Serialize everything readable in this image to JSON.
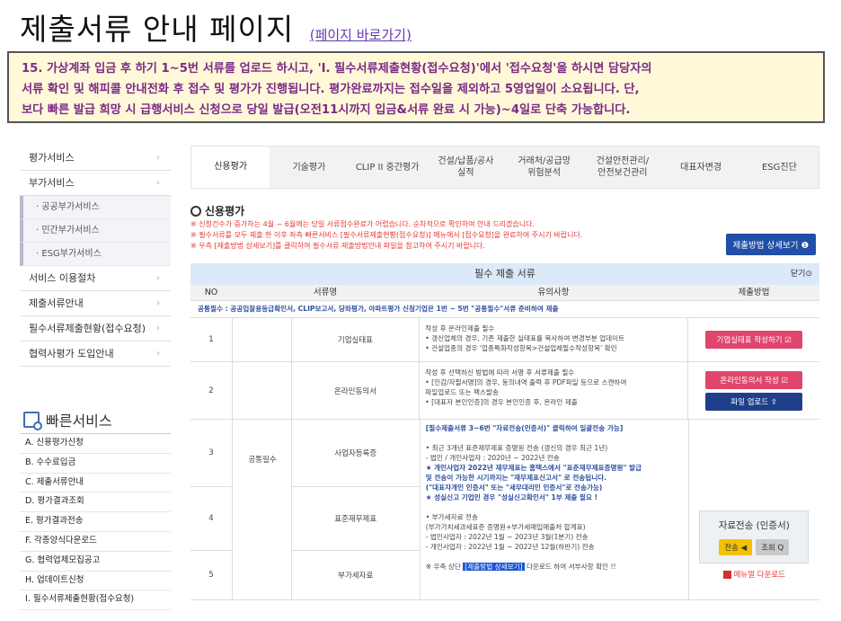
{
  "page": {
    "title": "제출서류 안내 페이지",
    "title_link": "(페이지 바로가기)",
    "notice": [
      "15. 가상계좌 입금 후 하기 1~5번 서류를 업로드 하시고, 'I. 필수서류제출현황(접수요청)'에서 '접수요청'을 하시면 담당자의",
      "서류 확인 및 해피콜 안내전화 후 접수 및 평가가 진행됩니다. 평가완료까지는 접수일을 제외하고 5영업일이 소요됩니다. 단,",
      "보다 빠른 발급 희망 시 급행서비스 신청으로 당일 발급(오전11시까지 입금&서류 완료 시 가능)~4일로 단축 가능합니다."
    ]
  },
  "sidebar": {
    "items": [
      {
        "label": "평가서비스"
      },
      {
        "label": "부가서비스"
      }
    ],
    "subitems": [
      "· 공공부가서비스",
      "· 민간부가서비스",
      "· ESG부가서비스"
    ],
    "items2": [
      {
        "label": "서비스 이용절차"
      },
      {
        "label": "제출서류안내"
      },
      {
        "label": "필수서류제출현황(접수요청)"
      },
      {
        "label": "협력사평가 도입안내"
      }
    ],
    "quick_title": "빠른서비스",
    "quick": [
      "A. 신용평가신청",
      "B. 수수료입금",
      "C. 제출서류안내",
      "D. 평가결과조회",
      "E. 평가결과전송",
      "F. 각종양식다운로드",
      "G. 협력업체모집공고",
      "H. 업데이트신청",
      "I. 필수서류제출현황(접수요청)"
    ]
  },
  "tabs": [
    {
      "label": "신용평가",
      "active": true
    },
    {
      "label": "기술평가"
    },
    {
      "label": "CLIP II 중간평가"
    },
    {
      "label": "건설/납품/공사\n실적"
    },
    {
      "label": "거래처/공급망\n위험분석"
    },
    {
      "label": "건설안전관리/\n안전보건관리"
    },
    {
      "label": "대표자변경"
    },
    {
      "label": "ESG진단"
    }
  ],
  "section": {
    "title": "신용평가",
    "notes": [
      "※ 신청건수가 증가하는 4월 ~ 6월에는 당일 서류접수완료가 어렵습니다. 순차적으로 확인하여 안내 드리겠습니다.",
      "※ 필수서류를 모두 제출 한 이후 좌측 빠른서비스 [필수서류제출현황(접수요청)] 메뉴에서 [접수요청]을 완료하여 주시기 바랍니다.",
      "※ 우측 [제출방법 상세보기]를 클릭하여 필수서류 제출방법안내 파일을 참고하여 주시기 바랍니다."
    ],
    "method_button": "제출방법 상세보기 ❶"
  },
  "table": {
    "title": "필수 제출 서류",
    "close": "닫기⊙",
    "headers": {
      "no": "NO",
      "name": "서류명",
      "note": "유의사항",
      "method": "제출방법"
    },
    "info": "공통필수 : 공공입찰용등급확인서, CLIP보고서, 당좌평가, 아파트평가 신청기업은 1번 ~ 5번 \"공통필수\"서류 준비하여 제출",
    "group": "공통필수",
    "rows": [
      {
        "no": "1",
        "name": "기업실태표",
        "notes": [
          "작성 후 온라인제출 필수",
          "• 갱신업체의 경우, 기존 제출한 실태표를 복사하여 변경부분 업데이트",
          "• 건설업종의 경우 '업종특화작성항목>건설업체필수작성항목' 확인"
        ],
        "buttons": [
          "기업실태표 작성하기 ☑"
        ]
      },
      {
        "no": "2",
        "name": "온라인동의서",
        "notes": [
          "작성 후 선택하신 방법에 따라 서명 후 서류제출 필수",
          "• [인감/자필서명]의 경우, 동의내역 출력 후 PDF파일 등으로 스캔하여",
          "파일업로드 또는 팩스발송",
          "• [대표자 본인인증]의 경우 본인인증 후, 온라인 제출"
        ],
        "buttons": [
          "온라인동의서 작성 ☑",
          "파일 업로드 ⇪"
        ]
      }
    ],
    "merged_note": [
      "[필수제출서류 3~6번 \"자료전송(인증서)\" 클릭하여 일괄전송 가능]",
      "",
      "• 최근 3개년 표준재무제표 증명원 전송 (갱신의 경우 최근 1년)",
      "- 법인 / 개인사업자 : 2020년 ~ 2022년 전송",
      "★ 개인사업자 2022년 재무제표는 홈택스에서 \"표준재무제표증명원\" 발급",
      "및 전송이 가능한 시기까지는 \"재무제표신고서\" 로 전송됩니다.",
      "(\"대표자개인 인증서\" 또는 \"세무대리인 인증서\"로 전송가능)",
      "★ 성실신고 기업인 경우 \"성실신고확인서\" 1부 제출 필요 !",
      "",
      "• 부가세자료 전송",
      "(부가가치세과세표준 증명원+부가세매입매출처 합계표)",
      "- 법인사업자 : 2022년 1월 ~ 2023년 3월(1분기) 전송",
      "- 개인사업자 : 2022년 1월 ~ 2022년 12월(하반기) 전송",
      "",
      "※ 우측 상단"
    ],
    "hl_text": "[제출방법 상세보기]",
    "after_hl": "다운로드 하여 서부사항 확인 !!",
    "rows_merged": [
      {
        "no": "3",
        "name": "사업자등록증"
      },
      {
        "no": "4",
        "name": "표준재무제표"
      },
      {
        "no": "5",
        "name": "부가세자료"
      }
    ],
    "send": {
      "title": "자료전송 (인증서)",
      "send_btn": "전송 ◀",
      "view_btn": "조회 Q",
      "manual": "메뉴얼 다운로드"
    }
  }
}
